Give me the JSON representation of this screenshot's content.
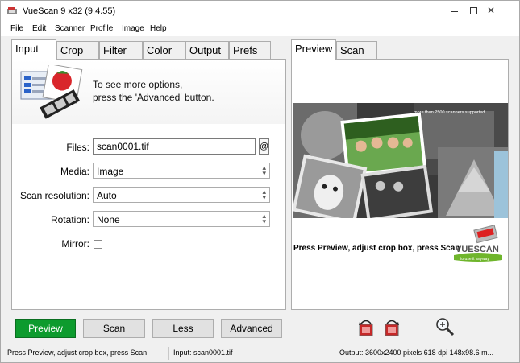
{
  "window": {
    "title": "VueScan 9 x32 (9.4.55)"
  },
  "menu": [
    "File",
    "Edit",
    "Scanner",
    "Profile",
    "Image",
    "Help"
  ],
  "left_tabs": [
    {
      "label": "Input",
      "active": true
    },
    {
      "label": "Crop",
      "active": false
    },
    {
      "label": "Filter",
      "active": false
    },
    {
      "label": "Color",
      "active": false
    },
    {
      "label": "Output",
      "active": false
    },
    {
      "label": "Prefs",
      "active": false
    }
  ],
  "right_tabs": [
    {
      "label": "Preview",
      "active": true
    },
    {
      "label": "Scan",
      "active": false
    }
  ],
  "info": {
    "line1": "To see more options,",
    "line2": "press the 'Advanced' button."
  },
  "form": {
    "files_label": "Files:",
    "files_value": "scan0001.tif",
    "files_button": "@",
    "media_label": "Media:",
    "media_value": "Image",
    "resolution_label": "Scan resolution:",
    "resolution_value": "Auto",
    "rotation_label": "Rotation:",
    "rotation_value": "None",
    "mirror_label": "Mirror:",
    "mirror_checked": false
  },
  "preview": {
    "banner_text": "more than 2500 scanners supported",
    "caption": "Press Preview, adjust crop box, press Scan",
    "logo_text": "VUESCAN",
    "logo_tagline": "to use it anyway"
  },
  "buttons": {
    "preview": "Preview",
    "scan": "Scan",
    "less": "Less",
    "advanced": "Advanced"
  },
  "status": {
    "left": "Press Preview, adjust crop box, press Scan",
    "middle": "Input: scan0001.tif",
    "right": "Output: 3600x2400 pixels 618 dpi 148x98.6 m..."
  },
  "colors": {
    "preview_button": "#0d9b2e",
    "logo_green": "#6fb52c"
  }
}
